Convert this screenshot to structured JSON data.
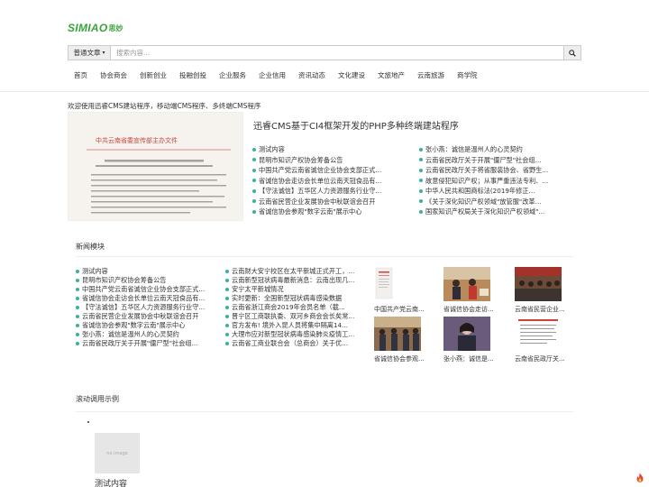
{
  "logo": {
    "text": "SIMIAO",
    "cn": "思妙"
  },
  "search": {
    "category": "普通文章",
    "placeholder": "搜索内容..."
  },
  "nav": [
    "首页",
    "协会商会",
    "创新创业",
    "投融创投",
    "企业服务",
    "企业信用",
    "资讯动态",
    "文化建设",
    "文旅地产",
    "云南旅游",
    "商学院"
  ],
  "welcome": "欢迎使用迅睿CMS建站程序，移动端CMS程序、多终端CMS程序",
  "featured": {
    "title": "迅睿CMS基于CI4框架开发的PHP多种终端建站程序",
    "image_text": "中共云南省委宣传部主办文件",
    "left_list": [
      "测试内容",
      "昆明市知识产权协会筹备公告",
      "中国共产党云南省诚信企业协会支部正式...",
      "省诚信协会走访会长单位云南天冠食品有...",
      "【守法诚信】五华区人力资源服务行业守...",
      "云南省民营企业发展协会中秋联谊会召开",
      "省诚信协会参观\"数字云南\"展示中心"
    ],
    "right_list": [
      "张小燕：诚信是温州人的心灵契约",
      "云南省民政厅关于开展\"僵尸型\"社会组...",
      "云南省民政厅关于将省服装协会、省野生...",
      "故意侵犯知识产权；从事严重违法专利、...",
      "中华人民共和国商标法(2019年修正...",
      "《关于深化知识产权领域\"放管服\"改革...",
      "国家知识产权局关于深化知识产权领域\"..."
    ]
  },
  "news": {
    "title": "新闻模块",
    "col1": [
      "测试内容",
      "昆明市知识产权协会筹备公告",
      "中国共产党云南省诚信企业协会支部正式...",
      "省诚信协会走访会长单位云南天冠食品有...",
      "【守法诚信】五华区人力资源服务行业守...",
      "云南省民营企业发展协会中秋联谊会召开",
      "省诚信协会参观\"数字云南\"展示中心",
      "张小燕：诚信是温州人的心灵契约",
      "云南省民政厅关于开展\"僵尸型\"社会组..."
    ],
    "col2": [
      "云南财大安宁校区在太平新城正式开工，...",
      "云南新型冠状病毒最新消息：云南出现几...",
      "安宁太平新城情况",
      "实时更新：全国新型冠状病毒感染数据",
      "云南省浙江商会2019年会员名单（截...",
      "晋宁区工商联执委、双河乡商会会长矣常...",
      "官方发布! 境外入昆人员将集中隔离14...",
      "大理市应对新型冠状病毒感染肺炎疫情工...",
      "云南省工商业联合会（总商会）关于优..."
    ],
    "thumbs": [
      {
        "caption": "中国共产党云南..."
      },
      {
        "caption": "省诚信协会走访..."
      },
      {
        "caption": "云南省民营企业..."
      },
      {
        "caption": "省诚信协会参观..."
      },
      {
        "caption": "张小燕：诚信是..."
      },
      {
        "caption": "云南省民政厅关..."
      }
    ]
  },
  "scroll": {
    "title": "滚动调用示例",
    "noimg": "no image",
    "caption": "测试内容"
  },
  "colors": {
    "accent": "#3bb0a3",
    "logo": "#3aa23a"
  }
}
